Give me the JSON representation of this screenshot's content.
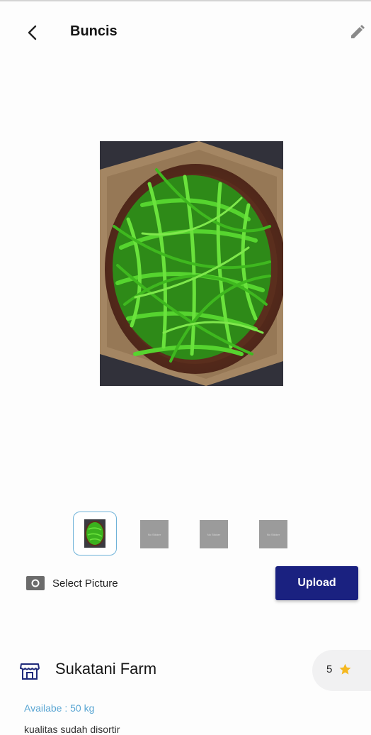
{
  "header": {
    "title": "Buncis"
  },
  "icons": {
    "back": "chevron-left-icon",
    "edit": "pencil-icon",
    "camera": "camera-icon",
    "store": "store-icon",
    "star": "star-icon"
  },
  "gallery": {
    "main_image": "green-beans-photo",
    "thumbnails": [
      {
        "kind": "photo",
        "selected": true
      },
      {
        "kind": "placeholder",
        "label": "No Sticker"
      },
      {
        "kind": "placeholder",
        "label": "No Sticker"
      },
      {
        "kind": "placeholder",
        "label": "No Sticker"
      }
    ]
  },
  "picker": {
    "select_label": "Select Picture",
    "upload_label": "Upload"
  },
  "farm": {
    "name": "Sukatani Farm",
    "rating": "5",
    "availability": "Availabe : 50 kg",
    "description": "kualitas sudah disortir"
  },
  "colors": {
    "primary_button": "#1a2180",
    "accent_text": "#5aa6d3",
    "star": "#f5b820",
    "selected_thumb_border": "#6fb3d9"
  }
}
